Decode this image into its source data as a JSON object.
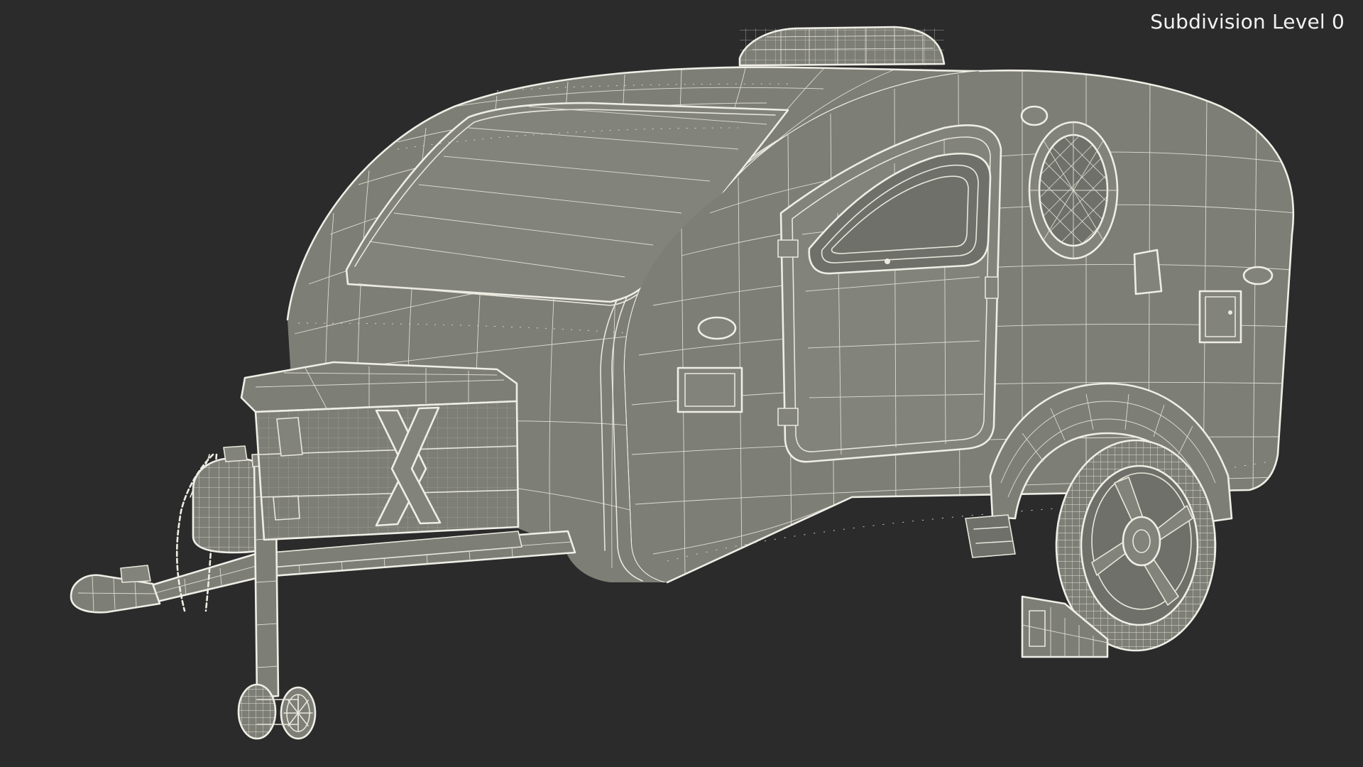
{
  "viewport": {
    "background": "#2b2b2b",
    "mesh_color": "#7d7e76",
    "wire_color": "#e9e7dc"
  },
  "overlay": {
    "subdivision_label": "Subdivision Level 0"
  }
}
